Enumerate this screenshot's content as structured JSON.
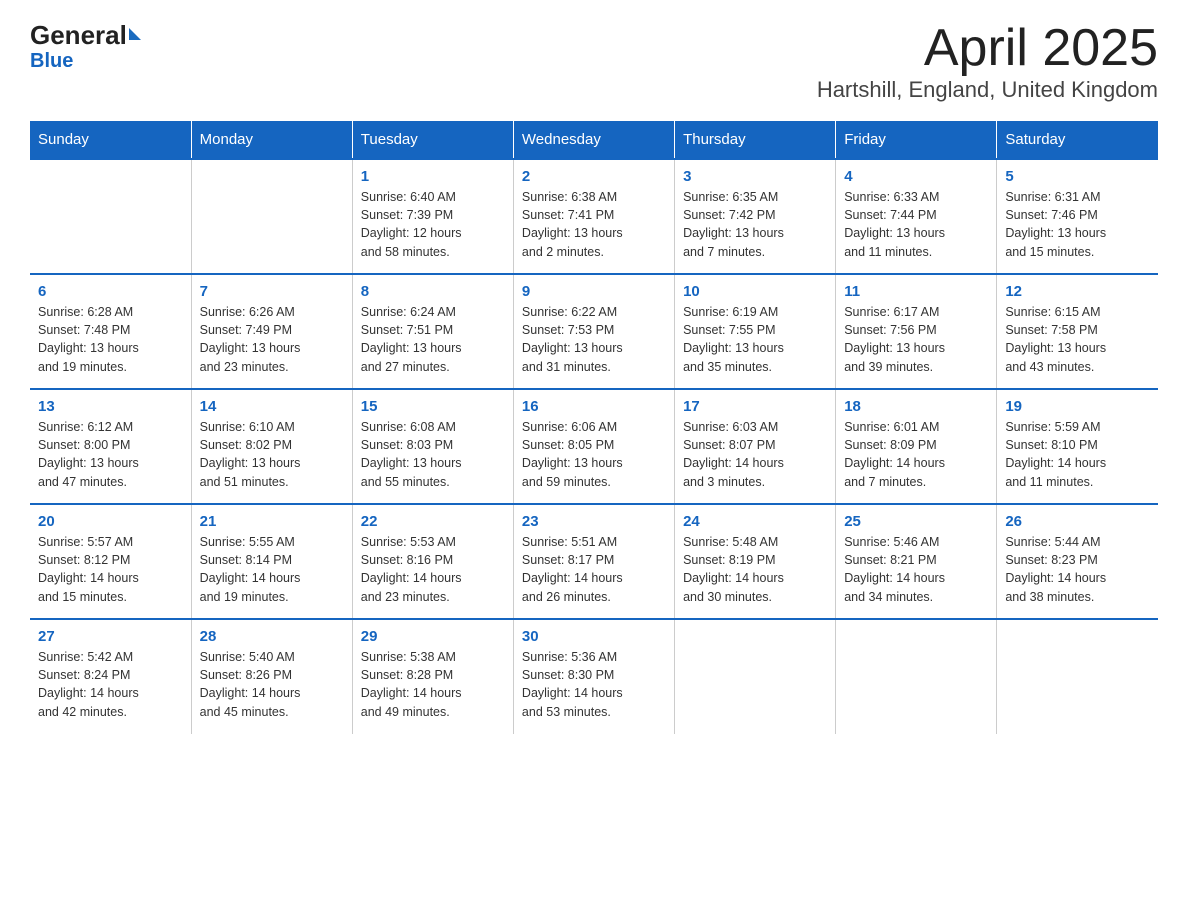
{
  "header": {
    "logo_general": "General",
    "logo_blue": "Blue",
    "title": "April 2025",
    "subtitle": "Hartshill, England, United Kingdom"
  },
  "columns": [
    "Sunday",
    "Monday",
    "Tuesday",
    "Wednesday",
    "Thursday",
    "Friday",
    "Saturday"
  ],
  "weeks": [
    [
      {
        "day": "",
        "info": ""
      },
      {
        "day": "",
        "info": ""
      },
      {
        "day": "1",
        "info": "Sunrise: 6:40 AM\nSunset: 7:39 PM\nDaylight: 12 hours\nand 58 minutes."
      },
      {
        "day": "2",
        "info": "Sunrise: 6:38 AM\nSunset: 7:41 PM\nDaylight: 13 hours\nand 2 minutes."
      },
      {
        "day": "3",
        "info": "Sunrise: 6:35 AM\nSunset: 7:42 PM\nDaylight: 13 hours\nand 7 minutes."
      },
      {
        "day": "4",
        "info": "Sunrise: 6:33 AM\nSunset: 7:44 PM\nDaylight: 13 hours\nand 11 minutes."
      },
      {
        "day": "5",
        "info": "Sunrise: 6:31 AM\nSunset: 7:46 PM\nDaylight: 13 hours\nand 15 minutes."
      }
    ],
    [
      {
        "day": "6",
        "info": "Sunrise: 6:28 AM\nSunset: 7:48 PM\nDaylight: 13 hours\nand 19 minutes."
      },
      {
        "day": "7",
        "info": "Sunrise: 6:26 AM\nSunset: 7:49 PM\nDaylight: 13 hours\nand 23 minutes."
      },
      {
        "day": "8",
        "info": "Sunrise: 6:24 AM\nSunset: 7:51 PM\nDaylight: 13 hours\nand 27 minutes."
      },
      {
        "day": "9",
        "info": "Sunrise: 6:22 AM\nSunset: 7:53 PM\nDaylight: 13 hours\nand 31 minutes."
      },
      {
        "day": "10",
        "info": "Sunrise: 6:19 AM\nSunset: 7:55 PM\nDaylight: 13 hours\nand 35 minutes."
      },
      {
        "day": "11",
        "info": "Sunrise: 6:17 AM\nSunset: 7:56 PM\nDaylight: 13 hours\nand 39 minutes."
      },
      {
        "day": "12",
        "info": "Sunrise: 6:15 AM\nSunset: 7:58 PM\nDaylight: 13 hours\nand 43 minutes."
      }
    ],
    [
      {
        "day": "13",
        "info": "Sunrise: 6:12 AM\nSunset: 8:00 PM\nDaylight: 13 hours\nand 47 minutes."
      },
      {
        "day": "14",
        "info": "Sunrise: 6:10 AM\nSunset: 8:02 PM\nDaylight: 13 hours\nand 51 minutes."
      },
      {
        "day": "15",
        "info": "Sunrise: 6:08 AM\nSunset: 8:03 PM\nDaylight: 13 hours\nand 55 minutes."
      },
      {
        "day": "16",
        "info": "Sunrise: 6:06 AM\nSunset: 8:05 PM\nDaylight: 13 hours\nand 59 minutes."
      },
      {
        "day": "17",
        "info": "Sunrise: 6:03 AM\nSunset: 8:07 PM\nDaylight: 14 hours\nand 3 minutes."
      },
      {
        "day": "18",
        "info": "Sunrise: 6:01 AM\nSunset: 8:09 PM\nDaylight: 14 hours\nand 7 minutes."
      },
      {
        "day": "19",
        "info": "Sunrise: 5:59 AM\nSunset: 8:10 PM\nDaylight: 14 hours\nand 11 minutes."
      }
    ],
    [
      {
        "day": "20",
        "info": "Sunrise: 5:57 AM\nSunset: 8:12 PM\nDaylight: 14 hours\nand 15 minutes."
      },
      {
        "day": "21",
        "info": "Sunrise: 5:55 AM\nSunset: 8:14 PM\nDaylight: 14 hours\nand 19 minutes."
      },
      {
        "day": "22",
        "info": "Sunrise: 5:53 AM\nSunset: 8:16 PM\nDaylight: 14 hours\nand 23 minutes."
      },
      {
        "day": "23",
        "info": "Sunrise: 5:51 AM\nSunset: 8:17 PM\nDaylight: 14 hours\nand 26 minutes."
      },
      {
        "day": "24",
        "info": "Sunrise: 5:48 AM\nSunset: 8:19 PM\nDaylight: 14 hours\nand 30 minutes."
      },
      {
        "day": "25",
        "info": "Sunrise: 5:46 AM\nSunset: 8:21 PM\nDaylight: 14 hours\nand 34 minutes."
      },
      {
        "day": "26",
        "info": "Sunrise: 5:44 AM\nSunset: 8:23 PM\nDaylight: 14 hours\nand 38 minutes."
      }
    ],
    [
      {
        "day": "27",
        "info": "Sunrise: 5:42 AM\nSunset: 8:24 PM\nDaylight: 14 hours\nand 42 minutes."
      },
      {
        "day": "28",
        "info": "Sunrise: 5:40 AM\nSunset: 8:26 PM\nDaylight: 14 hours\nand 45 minutes."
      },
      {
        "day": "29",
        "info": "Sunrise: 5:38 AM\nSunset: 8:28 PM\nDaylight: 14 hours\nand 49 minutes."
      },
      {
        "day": "30",
        "info": "Sunrise: 5:36 AM\nSunset: 8:30 PM\nDaylight: 14 hours\nand 53 minutes."
      },
      {
        "day": "",
        "info": ""
      },
      {
        "day": "",
        "info": ""
      },
      {
        "day": "",
        "info": ""
      }
    ]
  ]
}
